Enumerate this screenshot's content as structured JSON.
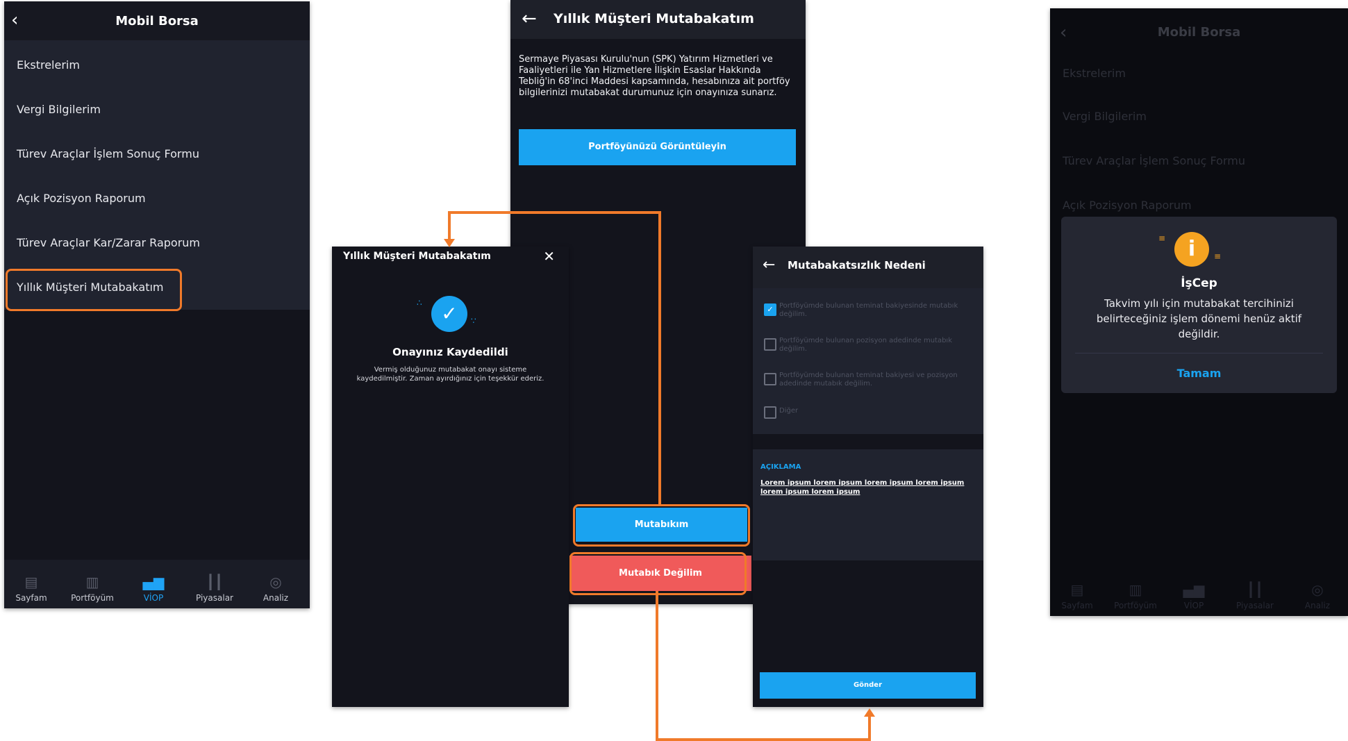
{
  "screen1": {
    "title": "Mobil Borsa",
    "menu": [
      "Ekstrelerim",
      "Vergi Bilgilerim",
      "Türev Araçlar İşlem Sonuç Formu",
      "Açık Pozisyon Raporum",
      "Türev Araçlar Kar/Zarar Raporum",
      "Yıllık Müşteri Mutabakatım"
    ],
    "tabs": [
      "Sayfam",
      "Portföyüm",
      "VİOP",
      "Piyasalar",
      "Analiz"
    ]
  },
  "screen2": {
    "title": "Yıllık Müşteri Mutabakatım",
    "paragraph": "Sermaye Piyasası Kurulu'nun (SPK) Yatırım Hizmetleri ve Faaliyetleri ile Yan Hizmetlere İlişkin Esaslar Hakkında Tebliğ'in 68'inci Maddesi kapsamında, hesabınıza ait portföy bilgilerinizi mutabakat durumunuz için onayınıza sunarız.",
    "portfolio_button": "Portföyünüzü Görüntüleyin",
    "agree_button": "Mutabıkım",
    "disagree_button": "Mutabık Değilim"
  },
  "screen3": {
    "title": "Yıllık Müşteri Mutabakatım",
    "heading": "Onayınız Kaydedildi",
    "message": "Vermiş olduğunuz mutabakat onayı sisteme kaydedilmiştir. Zaman ayırdığınız için teşekkür ederiz."
  },
  "screen4": {
    "title": "Mutabakatsızlık Nedeni",
    "options": [
      "Portföyümde bulunan teminat bakiyesinde mutabık değilim.",
      "Portföyümde bulunan pozisyon adedinde mutabık değilim.",
      "Portföyümde bulunan teminat bakiyesi ve pozisyon adedinde mutabık değilim.",
      "Diğer"
    ],
    "notes_label": "AÇIKLAMA",
    "notes_text": "Lorem ipsum lorem ipsum lorem ipsum lorem ipsum lorem ipsum lorem ipsum",
    "send_button": "Gönder"
  },
  "screen5": {
    "dialog_title": "İşCep",
    "dialog_message": "Takvim yılı için mutabakat tercihinizi belirteceğiniz işlem dönemi henüz aktif değildir.",
    "dialog_button": "Tamam"
  }
}
